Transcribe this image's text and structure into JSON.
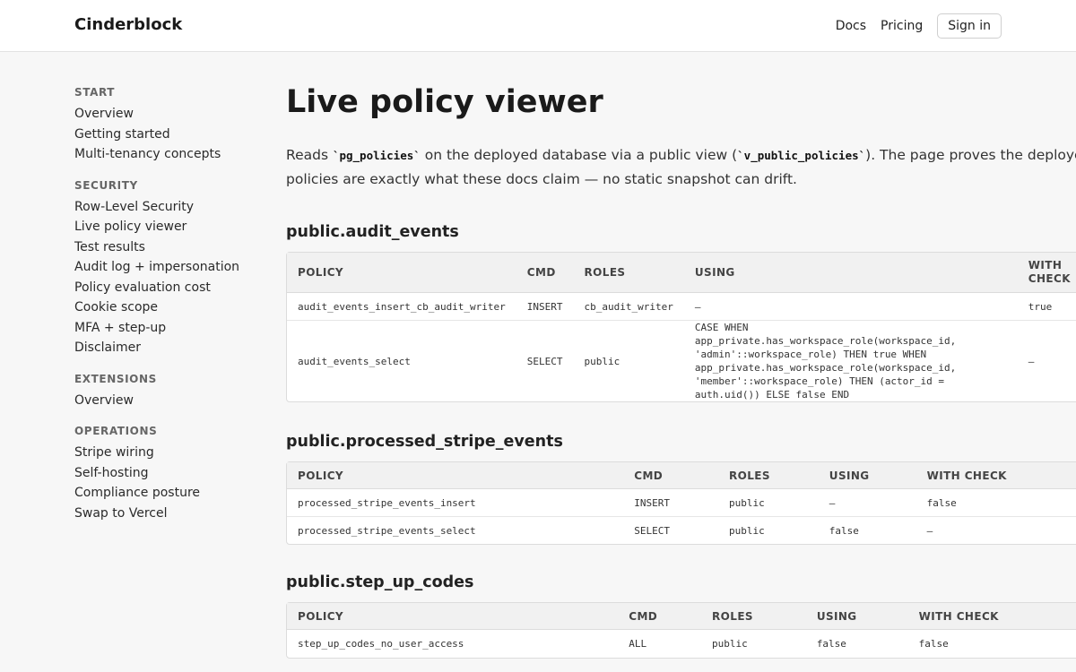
{
  "header": {
    "brand": "Cinderblock",
    "nav": {
      "docs": "Docs",
      "pricing": "Pricing",
      "signin": "Sign in"
    }
  },
  "sidebar": {
    "groups": [
      {
        "heading": "START",
        "items": [
          "Overview",
          "Getting started",
          "Multi-tenancy concepts"
        ]
      },
      {
        "heading": "SECURITY",
        "items": [
          "Row-Level Security",
          "Live policy viewer",
          "Test results",
          "Audit log + impersonation",
          "Policy evaluation cost",
          "Cookie scope",
          "MFA + step-up",
          "Disclaimer"
        ]
      },
      {
        "heading": "EXTENSIONS",
        "items": [
          "Overview"
        ]
      },
      {
        "heading": "OPERATIONS",
        "items": [
          "Stripe wiring",
          "Self-hosting",
          "Compliance posture",
          "Swap to Vercel"
        ]
      }
    ]
  },
  "main": {
    "title": "Live policy viewer",
    "intro": {
      "t1": "Reads ",
      "code1": "`pg_policies`",
      "t2": " on the deployed database via a public view (",
      "code2": "`v_public_policies`",
      "t3": "). The page proves the deployed policies are exactly what these docs claim — no static snapshot can drift."
    },
    "tables": [
      {
        "name": "public.audit_events",
        "headers": {
          "policy": "POLICY",
          "cmd": "CMD",
          "roles": "ROLES",
          "using": "USING",
          "with_check": "WITH CHECK"
        },
        "rows": [
          {
            "policy": "audit_events_insert_cb_audit_writer",
            "cmd": "INSERT",
            "roles": "cb_audit_writer",
            "using": "—",
            "with_check": "true"
          },
          {
            "policy": "audit_events_select",
            "cmd": "SELECT",
            "roles": "public",
            "using": "CASE WHEN app_private.has_workspace_role(workspace_id, 'admin'::workspace_role) THEN true WHEN app_private.has_workspace_role(workspace_id, 'member'::workspace_role) THEN (actor_id = auth.uid()) ELSE false END",
            "with_check": "—"
          }
        ]
      },
      {
        "name": "public.processed_stripe_events",
        "headers": {
          "policy": "POLICY",
          "cmd": "CMD",
          "roles": "ROLES",
          "using": "USING",
          "with_check": "WITH CHECK"
        },
        "rows": [
          {
            "policy": "processed_stripe_events_insert",
            "cmd": "INSERT",
            "roles": "public",
            "using": "—",
            "with_check": "false"
          },
          {
            "policy": "processed_stripe_events_select",
            "cmd": "SELECT",
            "roles": "public",
            "using": "false",
            "with_check": "—"
          }
        ]
      },
      {
        "name": "public.step_up_codes",
        "headers": {
          "policy": "POLICY",
          "cmd": "CMD",
          "roles": "ROLES",
          "using": "USING",
          "with_check": "WITH CHECK"
        },
        "rows": [
          {
            "policy": "step_up_codes_no_user_access",
            "cmd": "ALL",
            "roles": "public",
            "using": "false",
            "with_check": "false"
          }
        ]
      }
    ]
  }
}
